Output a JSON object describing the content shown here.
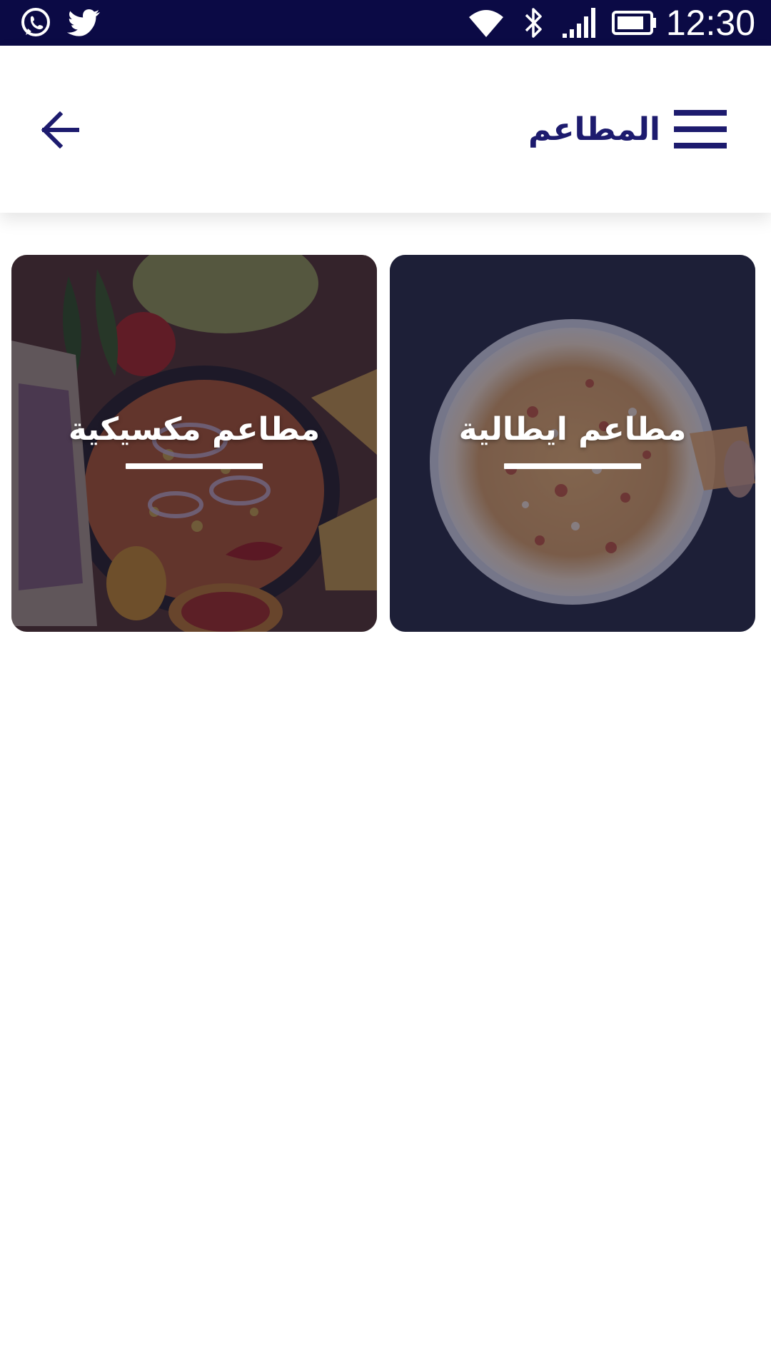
{
  "status_bar": {
    "time": "12:30",
    "left_icons": [
      "whatsapp-icon",
      "twitter-icon"
    ],
    "right_icons": [
      "wifi-icon",
      "bluetooth-icon",
      "signal-icon",
      "battery-icon"
    ]
  },
  "header": {
    "title": "المطاعم",
    "menu_icon": "hamburger-menu-icon",
    "back_icon": "arrow-left-icon"
  },
  "categories": [
    {
      "label": "مطاعم ايطالية",
      "image": "pizza-photo"
    },
    {
      "label": "مطاعم مكسيكية",
      "image": "mexican-food-photo"
    }
  ],
  "colors": {
    "status_bar": "#0b0a45",
    "accent": "#1d1b6e",
    "card_text": "#ffffff"
  }
}
